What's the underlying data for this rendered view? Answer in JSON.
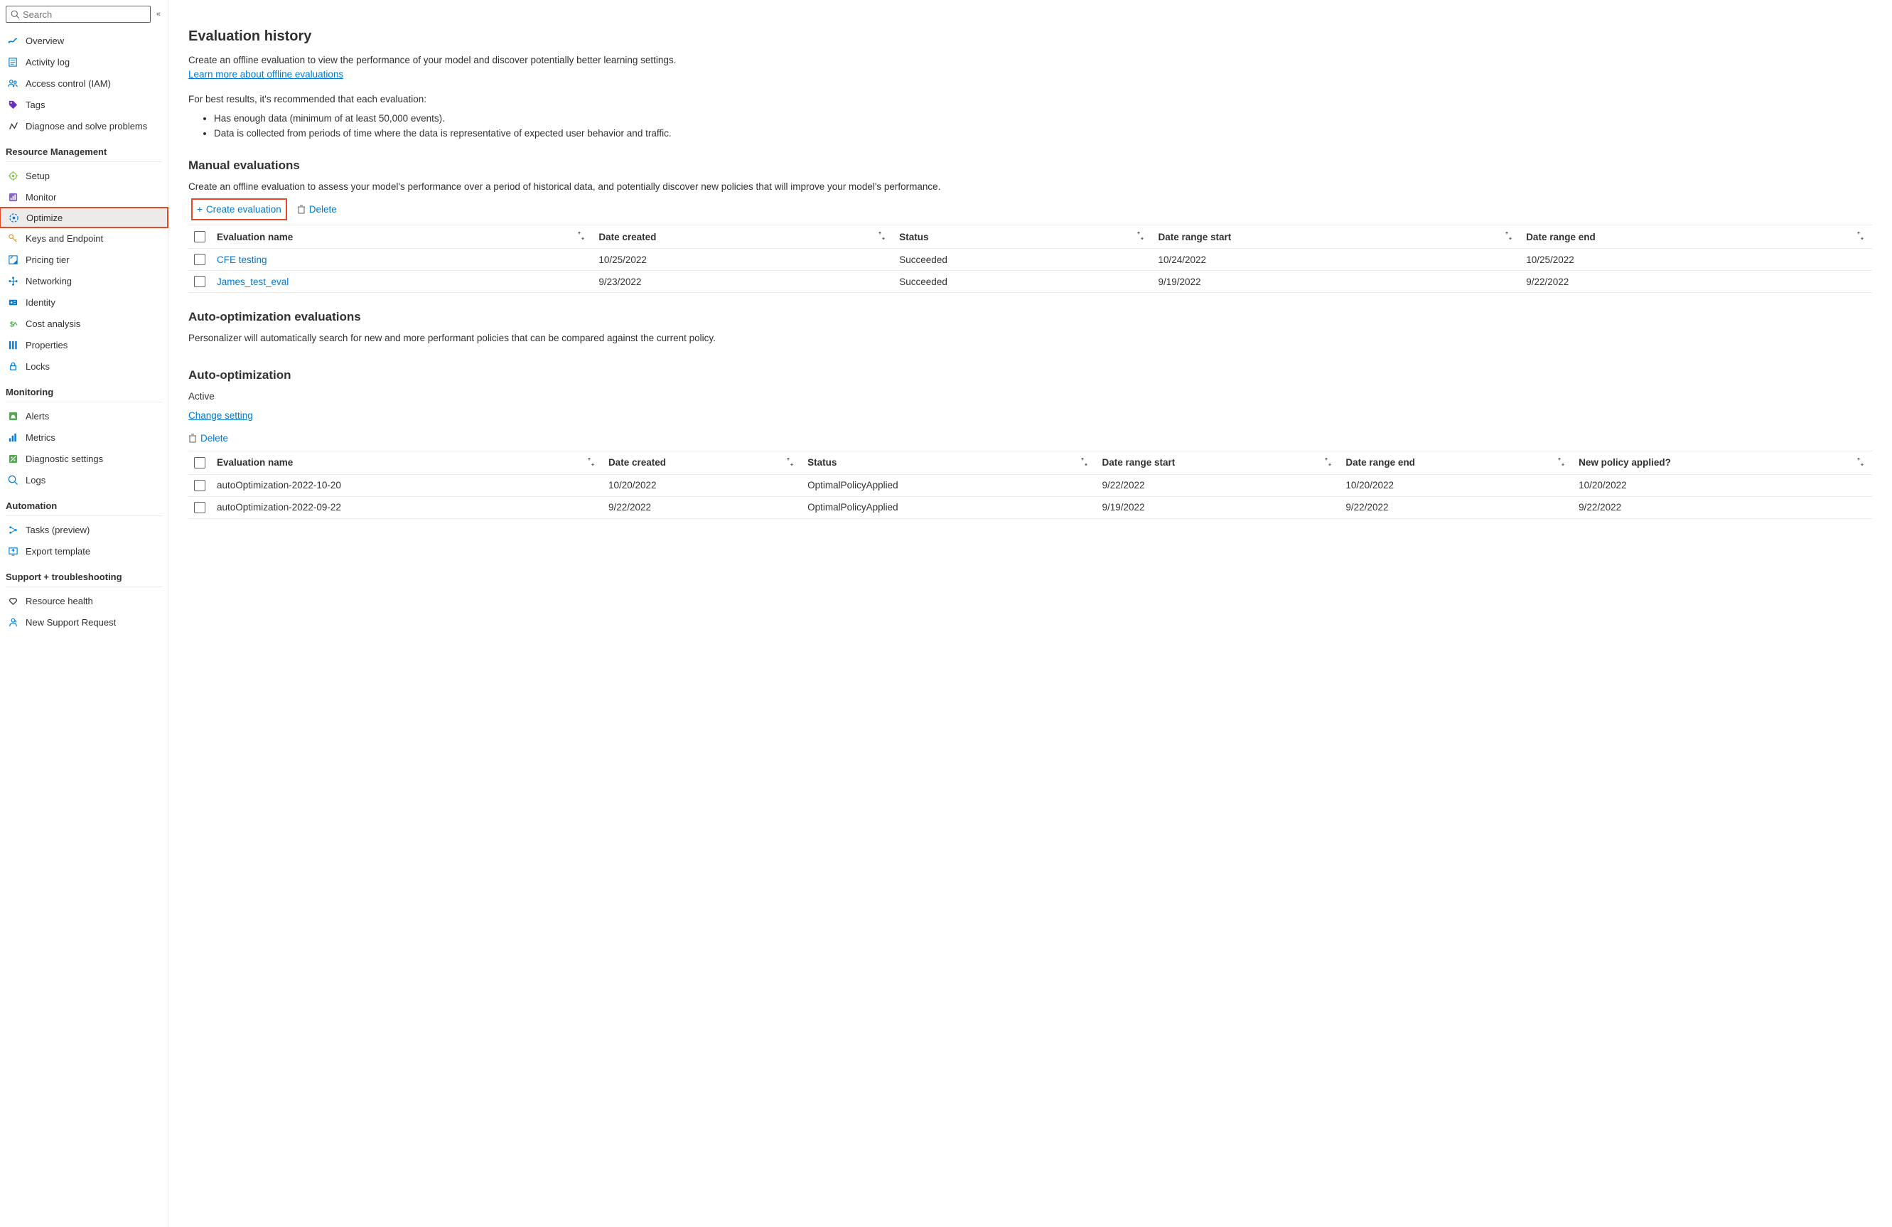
{
  "search": {
    "placeholder": "Search"
  },
  "sidebar": {
    "top_items": [
      {
        "icon": "overview-icon",
        "label": "Overview",
        "color": "#0078d4"
      },
      {
        "icon": "activity-log-icon",
        "label": "Activity log",
        "color": "#0078d4"
      },
      {
        "icon": "access-control-icon",
        "label": "Access control (IAM)",
        "color": "#0078d4"
      },
      {
        "icon": "tags-icon",
        "label": "Tags",
        "color": "#6b2fbd"
      },
      {
        "icon": "diagnose-icon",
        "label": "Diagnose and solve problems",
        "color": "#323130"
      }
    ],
    "sections": [
      {
        "header": "Resource Management",
        "items": [
          {
            "icon": "setup-icon",
            "label": "Setup",
            "color": "#7cc04b"
          },
          {
            "icon": "monitor-icon",
            "label": "Monitor",
            "color": "#8661c5"
          },
          {
            "icon": "optimize-icon",
            "label": "Optimize",
            "color": "#0078d4",
            "selected": true,
            "highlighted": true
          },
          {
            "icon": "keys-icon",
            "label": "Keys and Endpoint",
            "color": "#dba339"
          },
          {
            "icon": "pricing-icon",
            "label": "Pricing tier",
            "color": "#0078d4"
          },
          {
            "icon": "networking-icon",
            "label": "Networking",
            "color": "#0078d4"
          },
          {
            "icon": "identity-icon",
            "label": "Identity",
            "color": "#0078d4"
          },
          {
            "icon": "cost-icon",
            "label": "Cost analysis",
            "color": "#57a653"
          },
          {
            "icon": "properties-icon",
            "label": "Properties",
            "color": "#0078d4"
          },
          {
            "icon": "locks-icon",
            "label": "Locks",
            "color": "#0078d4"
          }
        ]
      },
      {
        "header": "Monitoring",
        "items": [
          {
            "icon": "alerts-icon",
            "label": "Alerts",
            "color": "#57a653"
          },
          {
            "icon": "metrics-icon",
            "label": "Metrics",
            "color": "#0078d4"
          },
          {
            "icon": "diagnostic-icon",
            "label": "Diagnostic settings",
            "color": "#57a653"
          },
          {
            "icon": "logs-icon",
            "label": "Logs",
            "color": "#0078d4"
          }
        ]
      },
      {
        "header": "Automation",
        "items": [
          {
            "icon": "tasks-icon",
            "label": "Tasks (preview)",
            "color": "#0078d4"
          },
          {
            "icon": "export-icon",
            "label": "Export template",
            "color": "#0078d4"
          }
        ]
      },
      {
        "header": "Support + troubleshooting",
        "items": [
          {
            "icon": "health-icon",
            "label": "Resource health",
            "color": "#323130"
          },
          {
            "icon": "support-icon",
            "label": "New Support Request",
            "color": "#0078d4"
          }
        ]
      }
    ]
  },
  "main": {
    "eval_history_heading": "Evaluation history",
    "desc1": "Create an offline evaluation to view the performance of your model and discover potentially better learning settings.",
    "learn_more": "Learn more about offline evaluations",
    "desc2": "For best results, it's recommended that each evaluation:",
    "bullets": [
      "Has enough data (minimum of at least 50,000 events).",
      "Data is collected from periods of time where the data is representative of expected user behavior and traffic."
    ],
    "manual_heading": "Manual evaluations",
    "manual_desc": "Create an offline evaluation to assess your model's performance over a period of historical data, and potentially discover new policies that will improve your model's performance.",
    "create_eval_label": "Create evaluation",
    "delete_label": "Delete",
    "manual_table": {
      "headers": [
        "Evaluation name",
        "Date created",
        "Status",
        "Date range start",
        "Date range end"
      ],
      "rows": [
        {
          "name": "CFE testing",
          "created": "10/25/2022",
          "status": "Succeeded",
          "start": "10/24/2022",
          "end": "10/25/2022",
          "link": true
        },
        {
          "name": "James_test_eval",
          "created": "9/23/2022",
          "status": "Succeeded",
          "start": "9/19/2022",
          "end": "9/22/2022",
          "link": true
        }
      ]
    },
    "auto_eval_heading": "Auto-optimization evaluations",
    "auto_eval_desc": "Personalizer will automatically search for new and more performant policies that can be compared against the current policy.",
    "auto_opt_heading": "Auto-optimization",
    "auto_opt_status": "Active",
    "change_setting": "Change setting",
    "auto_table": {
      "headers": [
        "Evaluation name",
        "Date created",
        "Status",
        "Date range start",
        "Date range end",
        "New policy applied?"
      ],
      "rows": [
        {
          "name": "autoOptimization-2022-10-20",
          "created": "10/20/2022",
          "status": "OptimalPolicyApplied",
          "start": "9/22/2022",
          "end": "10/20/2022",
          "applied": "10/20/2022"
        },
        {
          "name": "autoOptimization-2022-09-22",
          "created": "9/22/2022",
          "status": "OptimalPolicyApplied",
          "start": "9/19/2022",
          "end": "9/22/2022",
          "applied": "9/22/2022"
        }
      ]
    }
  }
}
